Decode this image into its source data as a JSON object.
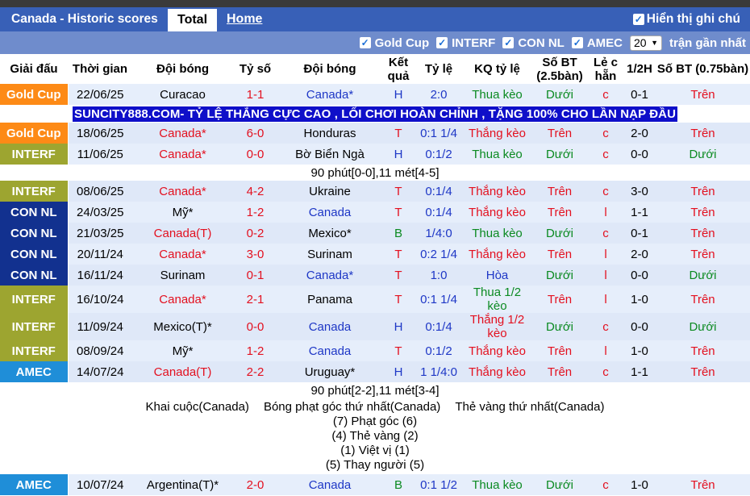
{
  "tabs": {
    "title": "Canada - Historic scores",
    "total": "Total",
    "home": "Home"
  },
  "display_option": "Hiển thị ghi chú",
  "filters": {
    "items": [
      "Gold Cup",
      "INTERF",
      "CON NL",
      "AMEC"
    ],
    "count": "20",
    "recent_label": "trận gần nhất"
  },
  "headers": [
    "Giải đấu",
    "Thời gian",
    "Đội bóng",
    "Tỷ số",
    "Đội bóng",
    "Kết quả",
    "Tỷ lệ",
    "KQ tỷ lệ",
    "Số BT (2.5bàn)",
    "Lẻ c hẵn",
    "1/2H",
    "Số BT (0.75bàn)"
  ],
  "banner": "SUNCITY888.COM- TỶ LỆ THẮNG CỰC CAO , LỐI CHƠI HOÀN CHỈNH , TẶNG 100% CHO LẦN NẠP ĐẦU",
  "rows": [
    {
      "league": "Gold Cup",
      "date": "22/06/25",
      "home": "Curacao",
      "score": "1-1",
      "away": "Canada*",
      "result": "H",
      "odds": "2:0",
      "kq": "Thua kèo",
      "bt25": "Dưới",
      "lc": "c",
      "h1": "0-1",
      "bt075": "Trên"
    },
    {
      "league": "Gold Cup",
      "date": "18/06/25",
      "home": "Canada*",
      "score": "6-0",
      "away": "Honduras",
      "result": "T",
      "odds": "0:1 1/4",
      "kq": "Thắng kèo",
      "bt25": "Trên",
      "lc": "c",
      "h1": "2-0",
      "bt075": "Trên"
    },
    {
      "league": "INTERF",
      "date": "11/06/25",
      "home": "Canada*",
      "score": "0-0",
      "away": "Bờ Biển Ngà",
      "result": "H",
      "odds": "0:1/2",
      "kq": "Thua kèo",
      "bt25": "Dưới",
      "lc": "c",
      "h1": "0-0",
      "bt075": "Dưới"
    },
    {
      "league": "INTERF",
      "date": "08/06/25",
      "home": "Canada*",
      "score": "4-2",
      "away": "Ukraine",
      "result": "T",
      "odds": "0:1/4",
      "kq": "Thắng kèo",
      "bt25": "Trên",
      "lc": "c",
      "h1": "3-0",
      "bt075": "Trên"
    },
    {
      "league": "CON NL",
      "date": "24/03/25",
      "home": "Mỹ*",
      "score": "1-2",
      "away": "Canada",
      "result": "T",
      "odds": "0:1/4",
      "kq": "Thắng kèo",
      "bt25": "Trên",
      "lc": "l",
      "h1": "1-1",
      "bt075": "Trên"
    },
    {
      "league": "CON NL",
      "date": "21/03/25",
      "home": "Canada(T)",
      "score": "0-2",
      "away": "Mexico*",
      "result": "B",
      "odds": "1/4:0",
      "kq": "Thua kèo",
      "bt25": "Dưới",
      "lc": "c",
      "h1": "0-1",
      "bt075": "Trên"
    },
    {
      "league": "CON NL",
      "date": "20/11/24",
      "home": "Canada*",
      "score": "3-0",
      "away": "Surinam",
      "result": "T",
      "odds": "0:2 1/4",
      "kq": "Thắng kèo",
      "bt25": "Trên",
      "lc": "l",
      "h1": "2-0",
      "bt075": "Trên"
    },
    {
      "league": "CON NL",
      "date": "16/11/24",
      "home": "Surinam",
      "score": "0-1",
      "away": "Canada*",
      "result": "T",
      "odds": "1:0",
      "kq": "Hòa",
      "bt25": "Dưới",
      "lc": "l",
      "h1": "0-0",
      "bt075": "Dưới"
    },
    {
      "league": "INTERF",
      "date": "16/10/24",
      "home": "Canada*",
      "score": "2-1",
      "away": "Panama",
      "result": "T",
      "odds": "0:1 1/4",
      "kq": "Thua 1/2 kèo",
      "bt25": "Trên",
      "lc": "l",
      "h1": "1-0",
      "bt075": "Trên"
    },
    {
      "league": "INTERF",
      "date": "11/09/24",
      "home": "Mexico(T)*",
      "score": "0-0",
      "away": "Canada",
      "result": "H",
      "odds": "0:1/4",
      "kq": "Thắng 1/2 kèo",
      "bt25": "Dưới",
      "lc": "c",
      "h1": "0-0",
      "bt075": "Dưới"
    },
    {
      "league": "INTERF",
      "date": "08/09/24",
      "home": "Mỹ*",
      "score": "1-2",
      "away": "Canada",
      "result": "T",
      "odds": "0:1/2",
      "kq": "Thắng kèo",
      "bt25": "Trên",
      "lc": "l",
      "h1": "1-0",
      "bt075": "Trên"
    },
    {
      "league": "AMEC",
      "date": "14/07/24",
      "home": "Canada(T)",
      "score": "2-2",
      "away": "Uruguay*",
      "result": "H",
      "odds": "1 1/4:0",
      "kq": "Thắng kèo",
      "bt25": "Trên",
      "lc": "c",
      "h1": "1-1",
      "bt075": "Trên"
    },
    {
      "league": "AMEC",
      "date": "10/07/24",
      "home": "Argentina(T)*",
      "score": "2-0",
      "away": "Canada",
      "result": "B",
      "odds": "0:1 1/2",
      "kq": "Thua kèo",
      "bt25": "Dưới",
      "lc": "c",
      "h1": "1-0",
      "bt075": "Trên"
    }
  ],
  "notes": {
    "ivory_coast": "90 phút[0-0],11 mét[4-5]",
    "uruguay": "90 phút[2-2],11 mét[3-4]",
    "stats": {
      "kickoff": "Khai cuộc(Canada)",
      "first_corner": "Bóng phạt góc thứ nhất(Canada)",
      "first_yellow": "Thẻ vàng thứ nhất(Canada)",
      "lines": [
        "(7) Phạt góc (6)",
        "(4) Thẻ vàng (2)",
        "(1) Việt vị (1)",
        "(5) Thay người (5)"
      ]
    }
  }
}
